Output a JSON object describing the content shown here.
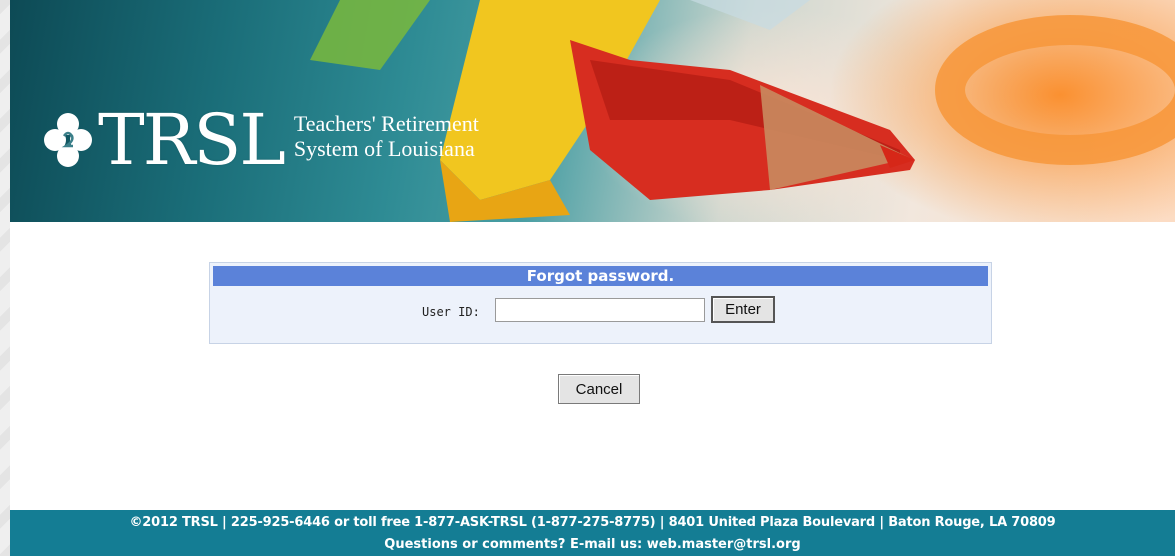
{
  "banner": {
    "logo_abbrev": "TRSL",
    "logo_line1": "Teachers' Retirement",
    "logo_line2": "System of Louisiana"
  },
  "forgot": {
    "title": "Forgot password.",
    "userid_label": "User ID:",
    "userid_value": "",
    "enter_label": "Enter"
  },
  "cancel_label": "Cancel",
  "footer": {
    "line1": "©2012 TRSL | 225-925-6446 or toll free 1-877-ASK-TRSL (1-877-275-8775) | 8401 United Plaza Boulevard | Baton Rouge, LA 70809",
    "questions": "Questions or comments? E-mail us:",
    "email": "web.master@trsl.org"
  },
  "colors": {
    "title_bar": "#5b82d9",
    "footer": "#147d94",
    "box_bg": "#edf2fb"
  }
}
